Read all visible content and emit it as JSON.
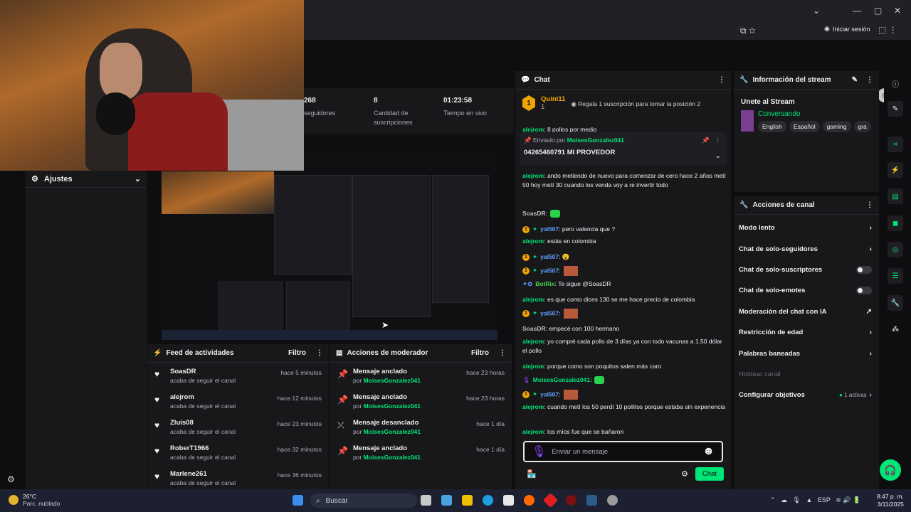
{
  "browser": {
    "login_label": "Iniciar sesión",
    "chevron": "⌄",
    "min": "—",
    "max": "▢",
    "close": "✕",
    "addr_icons": "⧉  ☆",
    "right_icons": "⬚  ⋮"
  },
  "stats": [
    {
      "value": "268",
      "label": "seguidores"
    },
    {
      "value": "8",
      "label": "Cantidad de suscripciones"
    },
    {
      "value": "01:23:58",
      "label": "Tiempo en vivo"
    }
  ],
  "ajustes": {
    "title": "Ajustes"
  },
  "feed": {
    "title": "Feed de actividades",
    "filter": "Filtro",
    "items": [
      {
        "name": "SoasDR",
        "sub": "acaba de seguir el canal",
        "time": "hace 5 minutos"
      },
      {
        "name": "alejrom",
        "sub": "acaba de seguir el canal",
        "time": "hace 12 minutos"
      },
      {
        "name": "Zluis08",
        "sub": "acaba de seguir el canal",
        "time": "hace 23 minutos"
      },
      {
        "name": "RoberT1966",
        "sub": "acaba de seguir el canal",
        "time": "hace 32 minutos"
      },
      {
        "name": "Marlene261",
        "sub": "acaba de seguir el canal",
        "time": "hace 36 minutos"
      }
    ]
  },
  "mod": {
    "title": "Acciones de moderador",
    "filter": "Filtro",
    "by_prefix": "por",
    "items": [
      {
        "action": "Mensaje anclado",
        "by": "MoisesGonzalez041",
        "time": "hace 23 horas",
        "icon": "pin-icon"
      },
      {
        "action": "Mensaje anclado",
        "by": "MoisesGonzalez041",
        "time": "hace 23 horas",
        "icon": "pin-icon"
      },
      {
        "action": "Mensaje desanclado",
        "by": "MoisesGonzalez041",
        "time": "hace 1 día",
        "icon": "unpin-icon"
      },
      {
        "action": "Mensaje anclado",
        "by": "MoisesGonzalez041",
        "time": "hace 1 día",
        "icon": "pin-icon"
      }
    ]
  },
  "chat": {
    "title": "Chat",
    "top_user": "Quini11",
    "top_rank": "1",
    "top_count": "1",
    "top_hint": "Regala 1 suscripción para tomar la posición 2",
    "pinned_by_prefix": "Enviado por",
    "pinned_by": "MoisesGonzalez041",
    "pinned_msg": "04265460791 MI PROVEDOR",
    "first_line_user": "alejrom",
    "first_line_text": ": 8 pollos por medio",
    "lines": [
      {
        "user": "alejrom",
        "text": ": ando metiendo de nuevo para comenzar de cero hace 2 años metí 50 hoy metí 30 cuando los venda voy a re invertir todo",
        "cls": "u1"
      },
      {
        "user": "SoasDR",
        "text": ":",
        "cls": "u2"
      },
      {
        "user": "yal507",
        "text": ": pero valencia que ?",
        "cls": "u3"
      },
      {
        "user": "alejrom",
        "text": ": estás en colombia",
        "cls": "u1"
      },
      {
        "user": "yal507",
        "text": ": 😮",
        "cls": "u3"
      },
      {
        "user": "yal507",
        "text": ":",
        "cls": "u3"
      },
      {
        "user": "BotRix",
        "text": ": Te sigue @SoasDR",
        "cls": "u5"
      },
      {
        "user": "alejrom",
        "text": ": es que como dices 130 se me hace precio de colombia",
        "cls": "u1"
      },
      {
        "user": "yal507",
        "text": ":",
        "cls": "u3"
      },
      {
        "user": "SoasDR",
        "text": ": empecé con 100 hermano",
        "cls": "u2"
      },
      {
        "user": "alejrom",
        "text": ": yo compré cada pollo de 3 días ya con todo vacunas a 1.50 dólar el pollo",
        "cls": "u1"
      },
      {
        "user": "alejrom",
        "text": ": porque como son poquitos salen más caro",
        "cls": "u1"
      },
      {
        "user": "MoisesGonzalez041",
        "text": ":",
        "cls": "u1"
      },
      {
        "user": "yal507",
        "text": ":",
        "cls": "u3"
      },
      {
        "user": "alejrom",
        "text": ": cuando metí los 50 perdí 10 pollitos porque estaba sin experiencia",
        "cls": "u1"
      },
      {
        "user": "alejrom",
        "text": ": los míos fue que se bañaron",
        "cls": "u1"
      }
    ],
    "input_placeholder": "Enviar un mensaje",
    "send_label": "Chat"
  },
  "stream_info": {
    "title": "Información del stream",
    "stream_title": "Unete al Stream",
    "category": "Conversando",
    "tags": [
      "English",
      "Español",
      "gaming",
      "gra"
    ]
  },
  "canal": {
    "title": "Acciones de canal",
    "items": [
      {
        "label": "Modo lento",
        "kind": "arrow"
      },
      {
        "label": "Chat de solo-seguidores",
        "kind": "arrow"
      },
      {
        "label": "Chat de solo-suscriptores",
        "kind": "toggle"
      },
      {
        "label": "Chat de solo-emotes",
        "kind": "toggle"
      },
      {
        "label": "Moderación del chat con IA",
        "kind": "ext"
      },
      {
        "label": "Restricción de edad",
        "kind": "arrow"
      },
      {
        "label": "Palabras baneadas",
        "kind": "arrow"
      },
      {
        "label": "Hostear canal",
        "kind": "disabled"
      },
      {
        "label": "Configurar objetivos",
        "kind": "goal",
        "extra": "1 activas"
      }
    ]
  },
  "taskbar": {
    "temp": "26°C",
    "weather": "Parc. nublado",
    "search": "Buscar",
    "lang": "ESP",
    "time": "8:47 p. m.",
    "date": "3/11/2025"
  },
  "colors": {
    "accent": "#00e676",
    "panel": "#18181b",
    "bg": "#0e0e10"
  }
}
